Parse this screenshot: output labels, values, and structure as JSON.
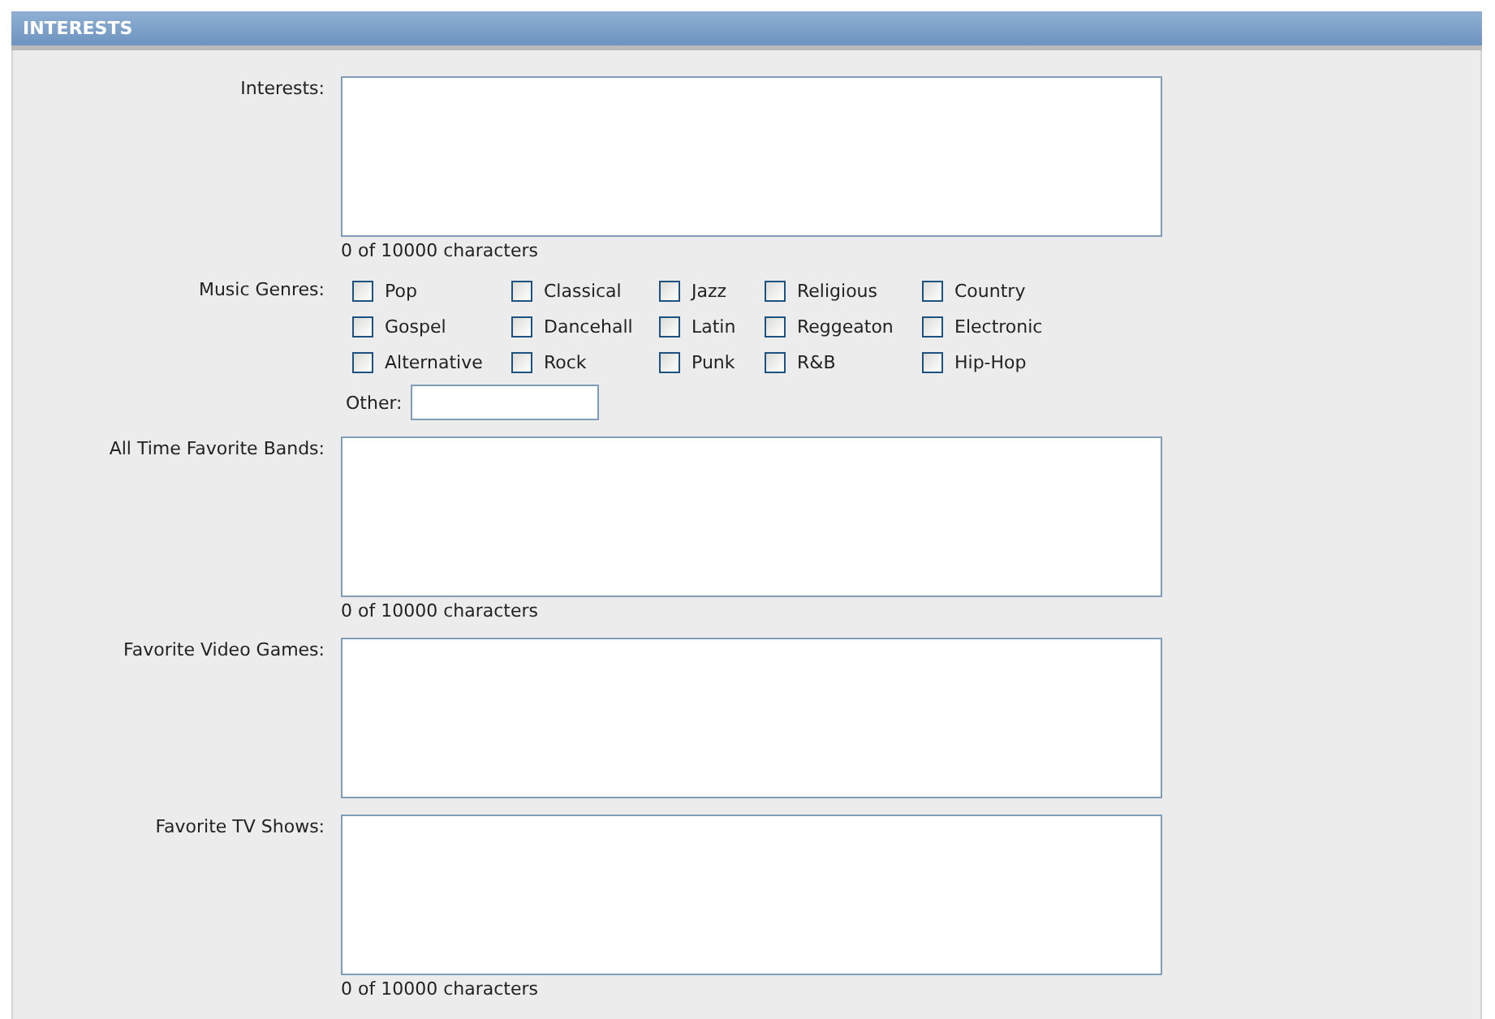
{
  "section": {
    "title": "INTERESTS"
  },
  "fields": [
    {
      "kind": "textarea",
      "label": "Interests:",
      "counter": "0 of 10000 characters"
    },
    {
      "kind": "checkboxes",
      "label": "Music Genres:",
      "options": [
        {
          "label": "Pop",
          "checked": false
        },
        {
          "label": "Classical",
          "checked": false
        },
        {
          "label": "Jazz",
          "checked": false
        },
        {
          "label": "Religious",
          "checked": false
        },
        {
          "label": "Country",
          "checked": false
        },
        {
          "label": "Gospel",
          "checked": false
        },
        {
          "label": "Dancehall",
          "checked": false
        },
        {
          "label": "Latin",
          "checked": false
        },
        {
          "label": "Reggeaton",
          "checked": false
        },
        {
          "label": "Electronic",
          "checked": false
        },
        {
          "label": "Alternative",
          "checked": false
        },
        {
          "label": "Rock",
          "checked": false
        },
        {
          "label": "Punk",
          "checked": false
        },
        {
          "label": "R&B",
          "checked": false
        },
        {
          "label": "Hip-Hop",
          "checked": false
        }
      ],
      "other": {
        "label": "Other:"
      }
    },
    {
      "kind": "textarea",
      "label": "All Time Favorite Bands:",
      "counter": "0 of 10000 characters"
    },
    {
      "kind": "textarea",
      "label": "Favorite Video Games:"
    },
    {
      "kind": "textarea",
      "label": "Favorite TV Shows:",
      "counter": "0 of 10000 characters"
    }
  ]
}
